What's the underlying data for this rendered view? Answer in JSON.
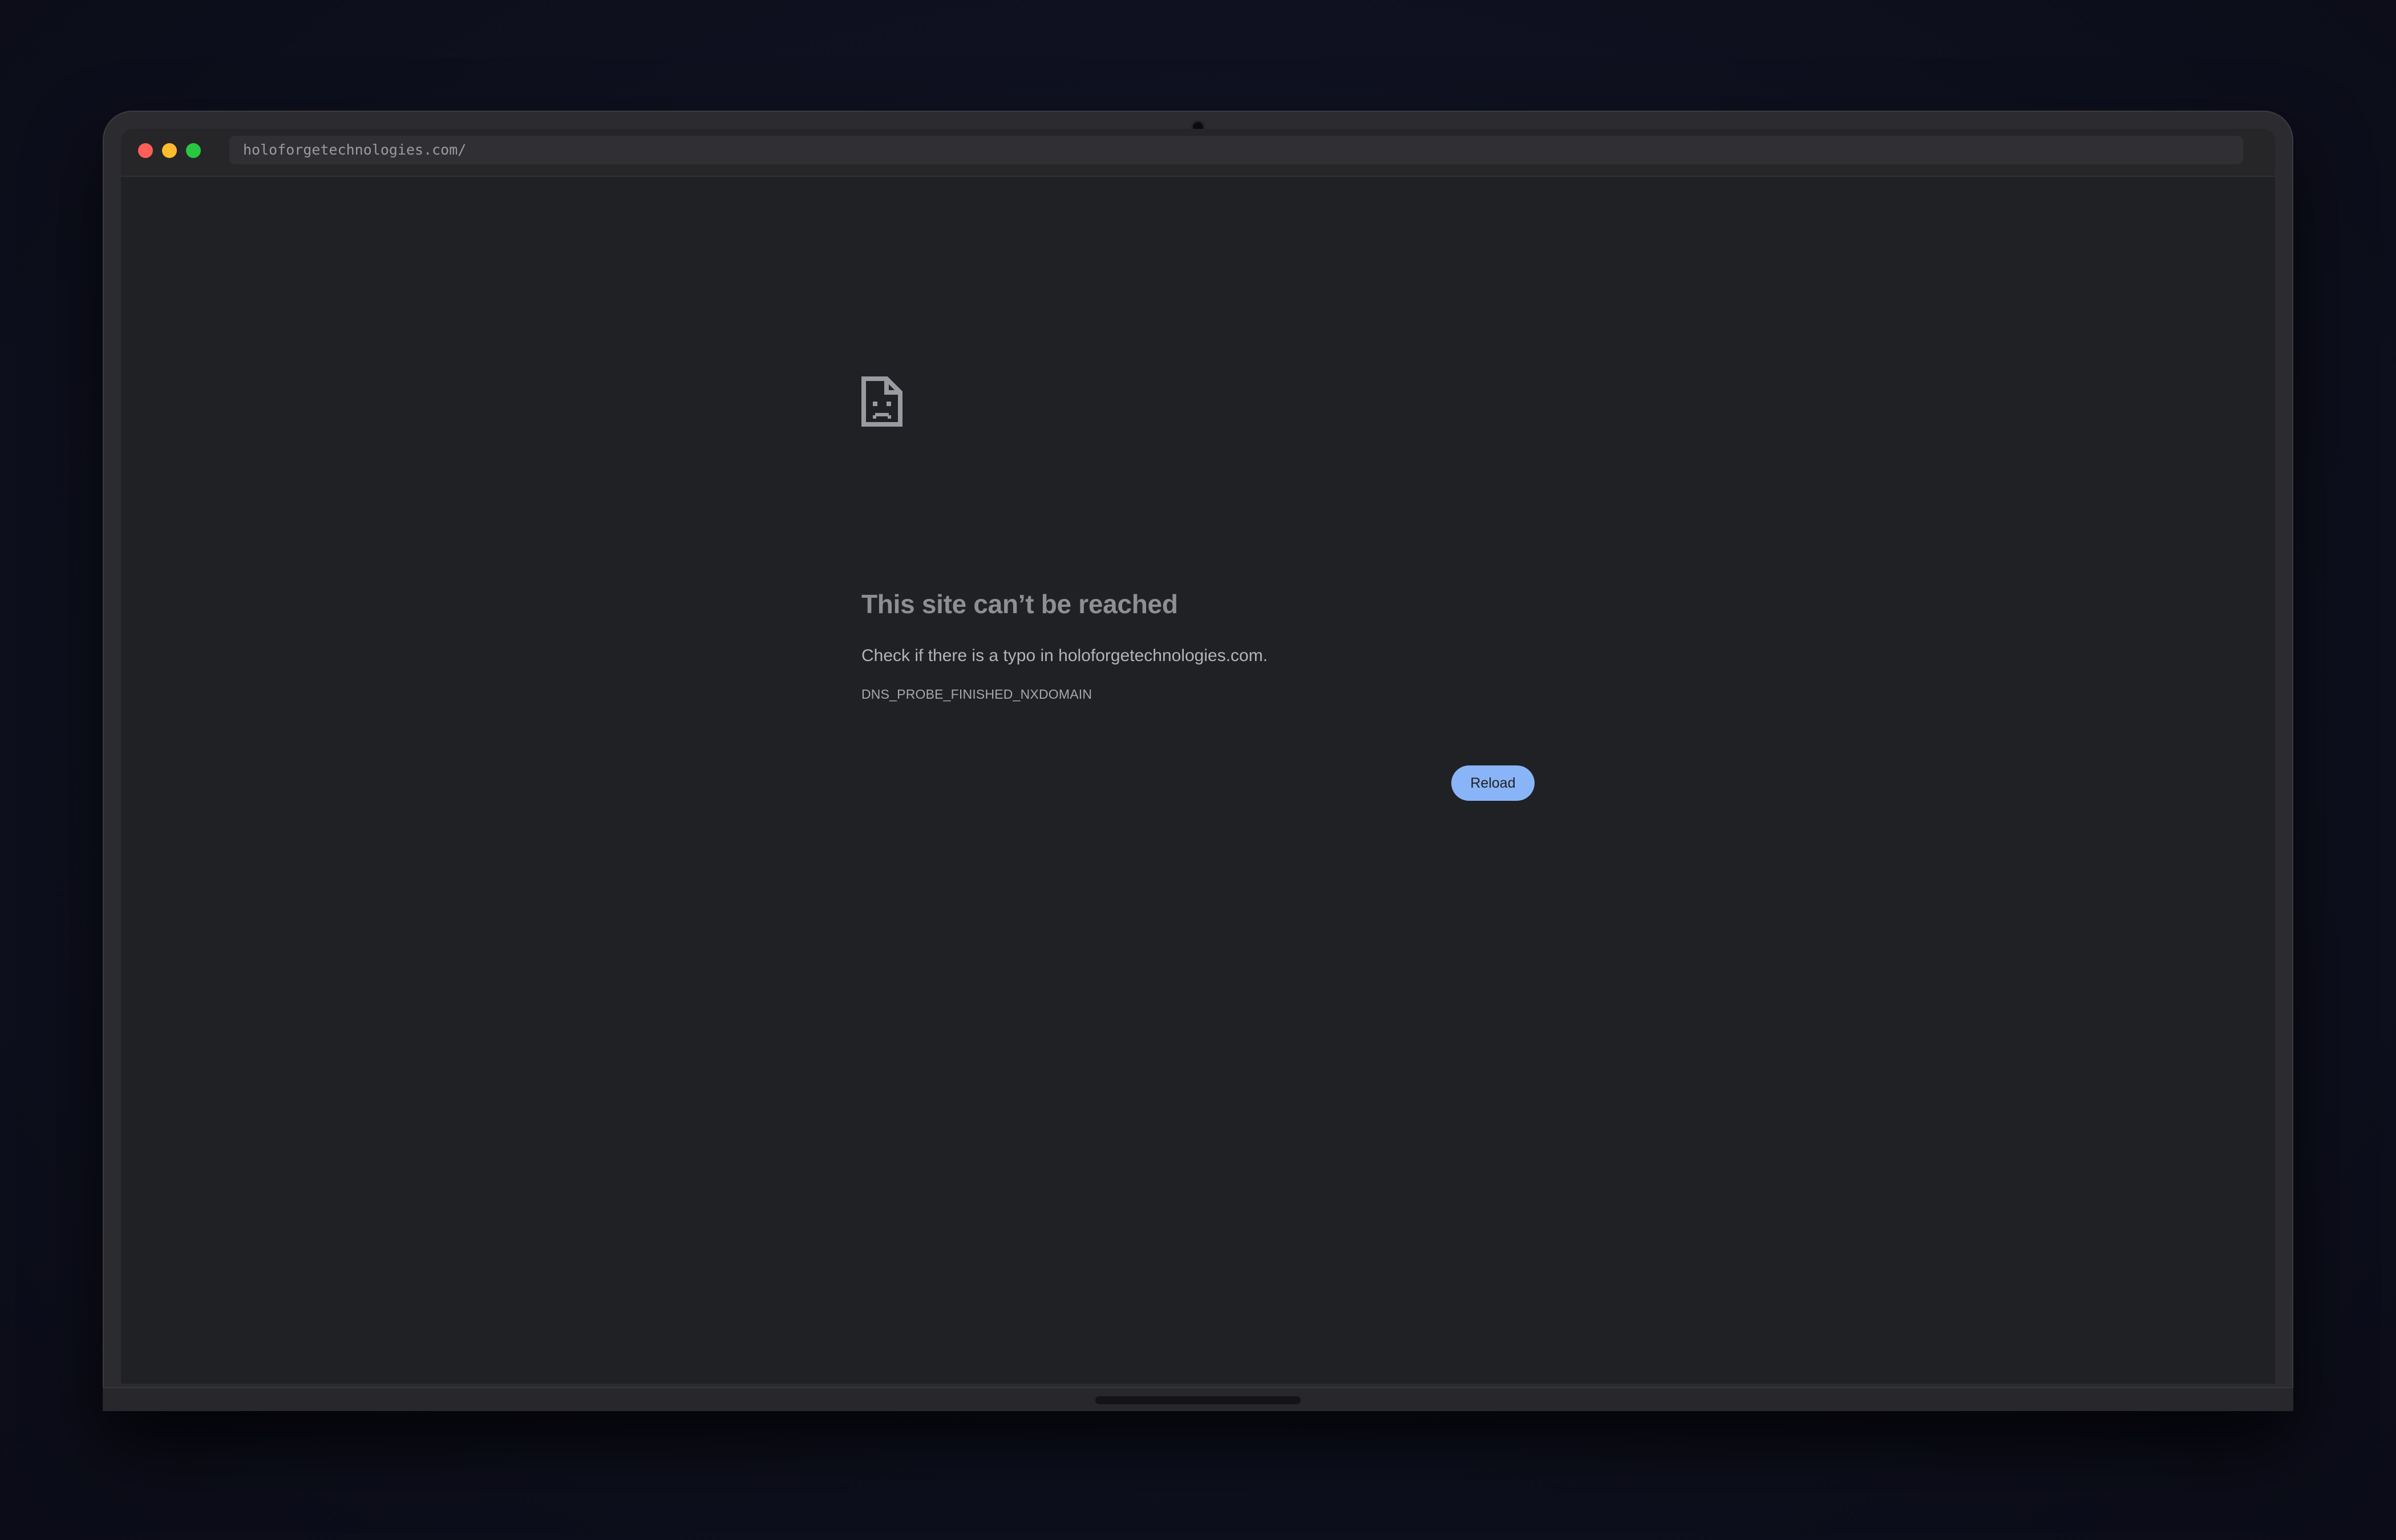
{
  "browser": {
    "url": "holoforgetechnologies.com/",
    "window_controls": {
      "close_color": "#ff5f57",
      "minimize_color": "#febc2e",
      "maximize_color": "#28c840"
    }
  },
  "error_page": {
    "icon": "sad-file-icon",
    "title": "This site can’t be reached",
    "message": "Check if there is a typo in holoforgetechnologies.com.",
    "error_code": "DNS_PROBE_FINISHED_NXDOMAIN",
    "reload_label": "Reload",
    "accent_color": "#8ab4f8",
    "background_color": "#202124"
  }
}
